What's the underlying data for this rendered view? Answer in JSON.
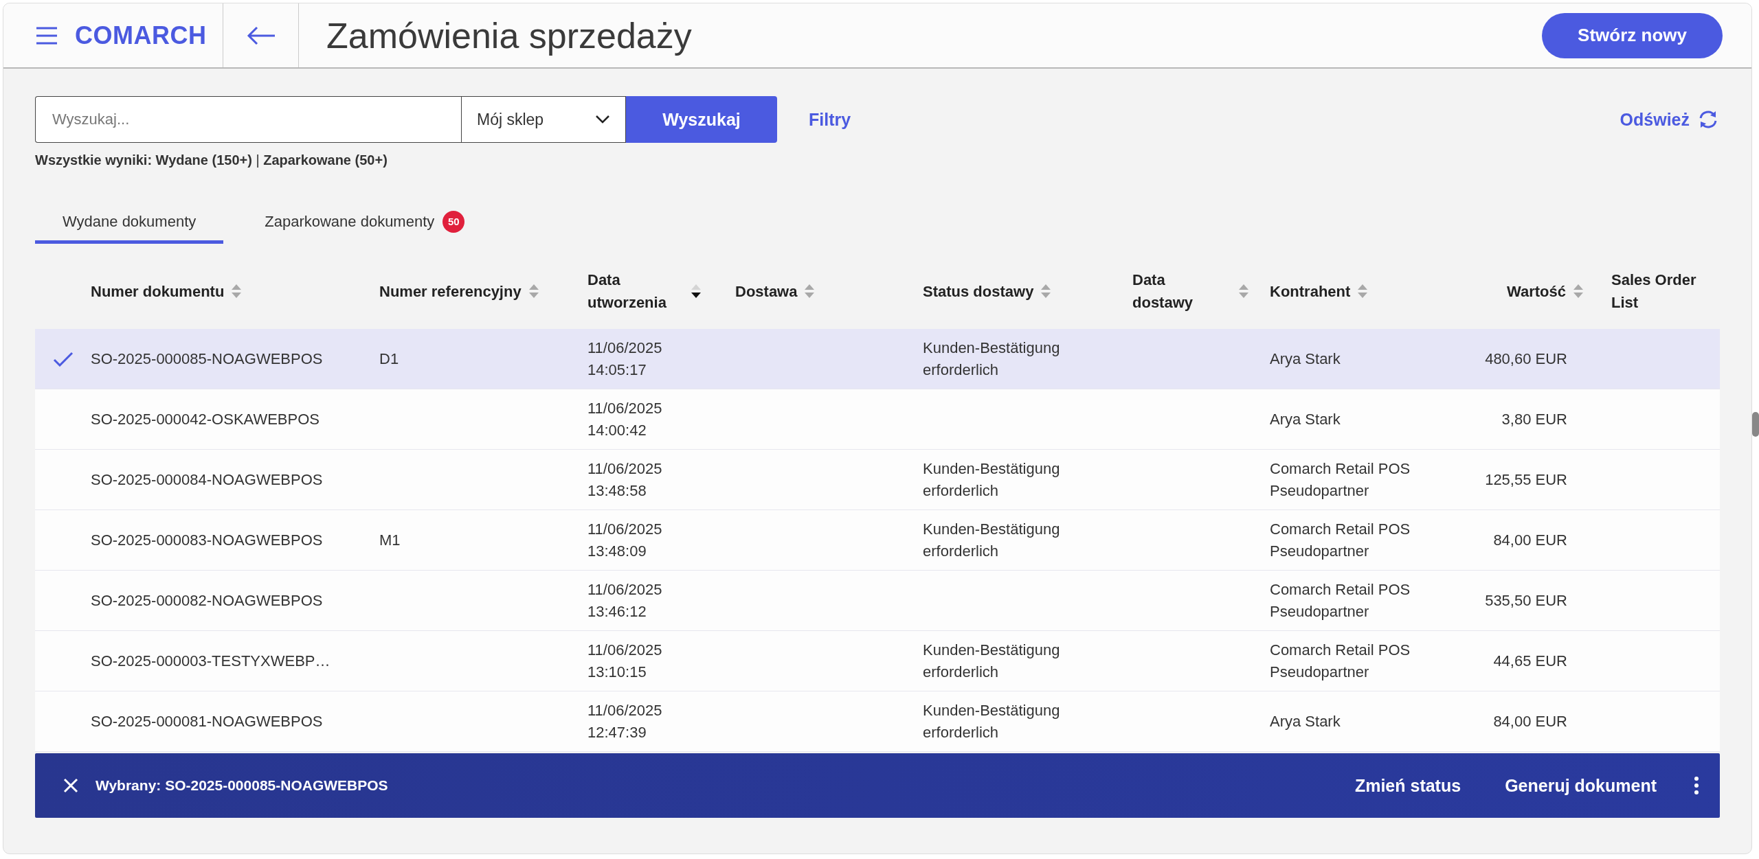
{
  "header": {
    "logo": "COMARCH",
    "title": "Zamówienia sprzedaży",
    "create_button": "Stwórz nowy"
  },
  "search": {
    "placeholder": "Wyszukaj...",
    "store": "Mój sklep",
    "search_button": "Wyszukaj",
    "filters": "Filtry",
    "refresh": "Odśwież"
  },
  "summary": "**Wszystkie wyniki: Wydane (150+)** | **Zaparkowane (50+)**",
  "tabs": [
    {
      "label": "Wydane dokumenty",
      "selected": true
    },
    {
      "label": "Zaparkowane dokumenty",
      "selected": false,
      "badge": "50"
    }
  ],
  "table": {
    "columns": [
      {
        "label": "Numer dokumentu",
        "sortable": true,
        "sorted_descending": false
      },
      {
        "label": "Numer referencyjny",
        "sortable": true,
        "sorted_descending": false
      },
      {
        "label": "Data utworzenia",
        "sortable": true,
        "sorted_descending": true
      },
      {
        "label": "Dostawa",
        "sortable": true,
        "sorted_descending": false
      },
      {
        "label": "Status dostawy",
        "sortable": true,
        "sorted_descending": false
      },
      {
        "label": "Data dostawy",
        "sortable": true,
        "sorted_descending": false
      },
      {
        "label": "Kontrahent",
        "sortable": true,
        "sorted_descending": false
      },
      {
        "label": "Wartość",
        "sortable": true,
        "sorted_descending": false
      },
      {
        "label": "Sales Order List",
        "sortable": false
      }
    ],
    "rows": [
      {
        "selected": true,
        "document": "SO-2025-000085-NOAGWEBPOS",
        "reference": "D1",
        "created_date": "11/06/2025",
        "created_time": "14:05:17",
        "delivery_status": "Kunden-Bestätigung erforderlich",
        "contractor": "Arya Stark",
        "value": "480,60 EUR"
      },
      {
        "selected": false,
        "document": "SO-2025-000042-OSKAWEBPOS",
        "created_date": "11/06/2025",
        "created_time": "14:00:42",
        "contractor": "Arya Stark",
        "value": "3,80 EUR"
      },
      {
        "selected": false,
        "document": "SO-2025-000084-NOAGWEBPOS",
        "created_date": "11/06/2025",
        "created_time": "13:48:58",
        "delivery_status": "Kunden-Bestätigung erforderlich",
        "contractor": "Comarch Retail POS Pseudopartner",
        "value": "125,55 EUR"
      },
      {
        "selected": false,
        "document": "SO-2025-000083-NOAGWEBPOS",
        "reference": "M1",
        "created_date": "11/06/2025",
        "created_time": "13:48:09",
        "delivery_status": "Kunden-Bestätigung erforderlich",
        "contractor": "Comarch Retail POS Pseudopartner",
        "value": "84,00 EUR"
      },
      {
        "selected": false,
        "document": "SO-2025-000082-NOAGWEBPOS",
        "created_date": "11/06/2025",
        "created_time": "13:46:12",
        "contractor": "Comarch Retail POS Pseudopartner",
        "value": "535,50 EUR"
      },
      {
        "selected": false,
        "document": "SO-2025-000003-TESTYXWEBP…",
        "created_date": "11/06/2025",
        "created_time": "13:10:15",
        "delivery_status": "Kunden-Bestätigung erforderlich",
        "contractor": "Comarch Retail POS Pseudopartner",
        "value": "44,65 EUR"
      },
      {
        "selected": false,
        "document": "SO-2025-000081-NOAGWEBPOS",
        "created_date": "11/06/2025",
        "created_time": "12:47:39",
        "delivery_status": "Kunden-Bestätigung erforderlich",
        "contractor": "Arya Stark",
        "value": "84,00 EUR"
      }
    ]
  },
  "selection_bar": {
    "selected_text": "Wybrany: SO-2025-000085-NOAGWEBPOS",
    "change_status": "Zmień status",
    "generate_document": "Generuj dokument"
  }
}
